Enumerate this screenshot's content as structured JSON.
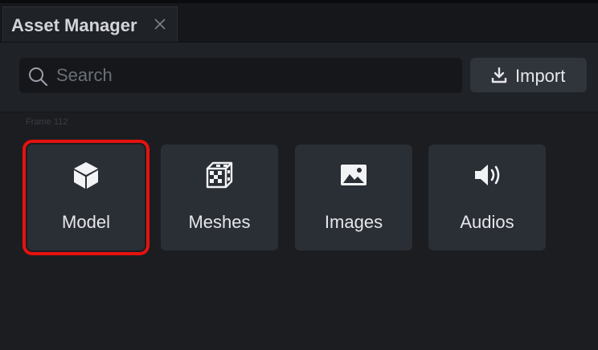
{
  "window": {
    "tab_title": "Asset Manager",
    "tab_close_icon": "close-icon"
  },
  "toolbar": {
    "search_placeholder": "Search",
    "search_value": "",
    "search_icon": "search-icon",
    "import_label": "Import",
    "import_icon": "download-icon"
  },
  "content": {
    "frame_label": "Frame 112",
    "cards": [
      {
        "label": "Model",
        "icon": "cube-icon",
        "selected": true
      },
      {
        "label": "Meshes",
        "icon": "dice-icon",
        "selected": false
      },
      {
        "label": "Images",
        "icon": "image-icon",
        "selected": false
      },
      {
        "label": "Audios",
        "icon": "volume-icon",
        "selected": false
      }
    ]
  },
  "colors": {
    "background": "#1b1d21",
    "panel": "#1f2227",
    "card": "#2a2e35",
    "selection_outline": "#e5120f",
    "text": "#e6e7ea",
    "placeholder": "#6b6f77"
  }
}
